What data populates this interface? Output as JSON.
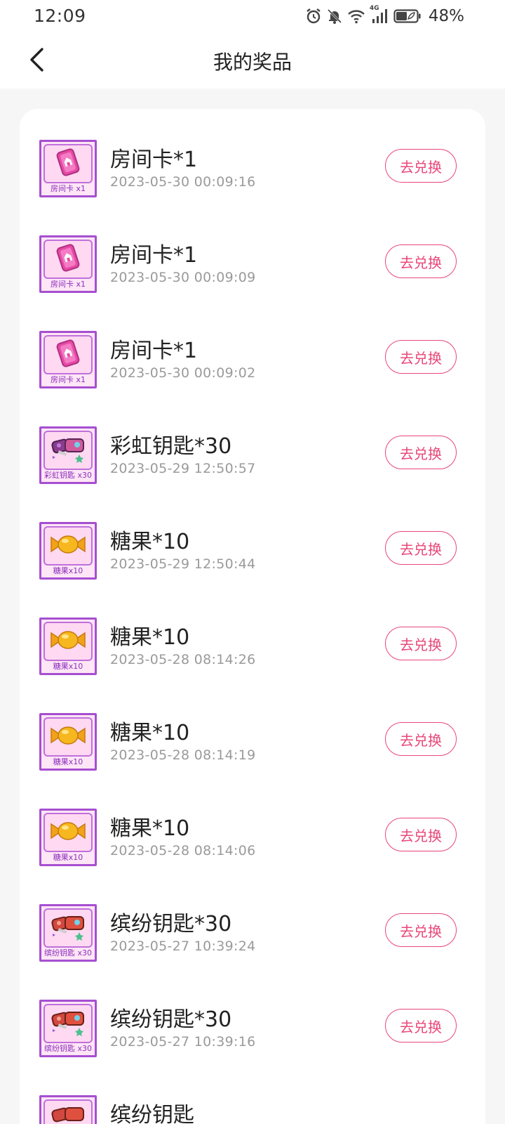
{
  "status_bar": {
    "time": "12:09",
    "network_label": "4G",
    "battery": "48%"
  },
  "header": {
    "title": "我的奖品",
    "back_icon": "chevron-left-icon"
  },
  "colors": {
    "accent": "#e8477a",
    "thumb_border": "#a64fd0",
    "thumb_bg": "#ffe6f6"
  },
  "prizes": [
    {
      "name": "房间卡*1",
      "time": "2023-05-30 00:09:16",
      "thumb_label": "房间卡 x1",
      "icon": "room-card-icon",
      "action": "去兑换"
    },
    {
      "name": "房间卡*1",
      "time": "2023-05-30 00:09:09",
      "thumb_label": "房间卡 x1",
      "icon": "room-card-icon",
      "action": "去兑换"
    },
    {
      "name": "房间卡*1",
      "time": "2023-05-30 00:09:02",
      "thumb_label": "房间卡 x1",
      "icon": "room-card-icon",
      "action": "去兑换"
    },
    {
      "name": "彩虹钥匙*30",
      "time": "2023-05-29 12:50:57",
      "thumb_label": "彩虹钥匙 x30",
      "icon": "key-icon",
      "action": "去兑换"
    },
    {
      "name": "糖果*10",
      "time": "2023-05-29 12:50:44",
      "thumb_label": "糖果x10",
      "icon": "candy-icon",
      "action": "去兑换"
    },
    {
      "name": "糖果*10",
      "time": "2023-05-28 08:14:26",
      "thumb_label": "糖果x10",
      "icon": "candy-icon",
      "action": "去兑换"
    },
    {
      "name": "糖果*10",
      "time": "2023-05-28 08:14:19",
      "thumb_label": "糖果x10",
      "icon": "candy-icon",
      "action": "去兑换"
    },
    {
      "name": "糖果*10",
      "time": "2023-05-28 08:14:06",
      "thumb_label": "糖果x10",
      "icon": "candy-icon",
      "action": "去兑换"
    },
    {
      "name": "缤纷钥匙*30",
      "time": "2023-05-27 10:39:24",
      "thumb_label": "缤纷钥匙 x30",
      "icon": "key-icon",
      "action": "去兑换"
    },
    {
      "name": "缤纷钥匙*30",
      "time": "2023-05-27 10:39:16",
      "thumb_label": "缤纷钥匙 x30",
      "icon": "key-icon",
      "action": "去兑换"
    },
    {
      "name": "缤纷钥匙",
      "time": "",
      "thumb_label": "",
      "icon": "key-icon",
      "action": ""
    }
  ]
}
